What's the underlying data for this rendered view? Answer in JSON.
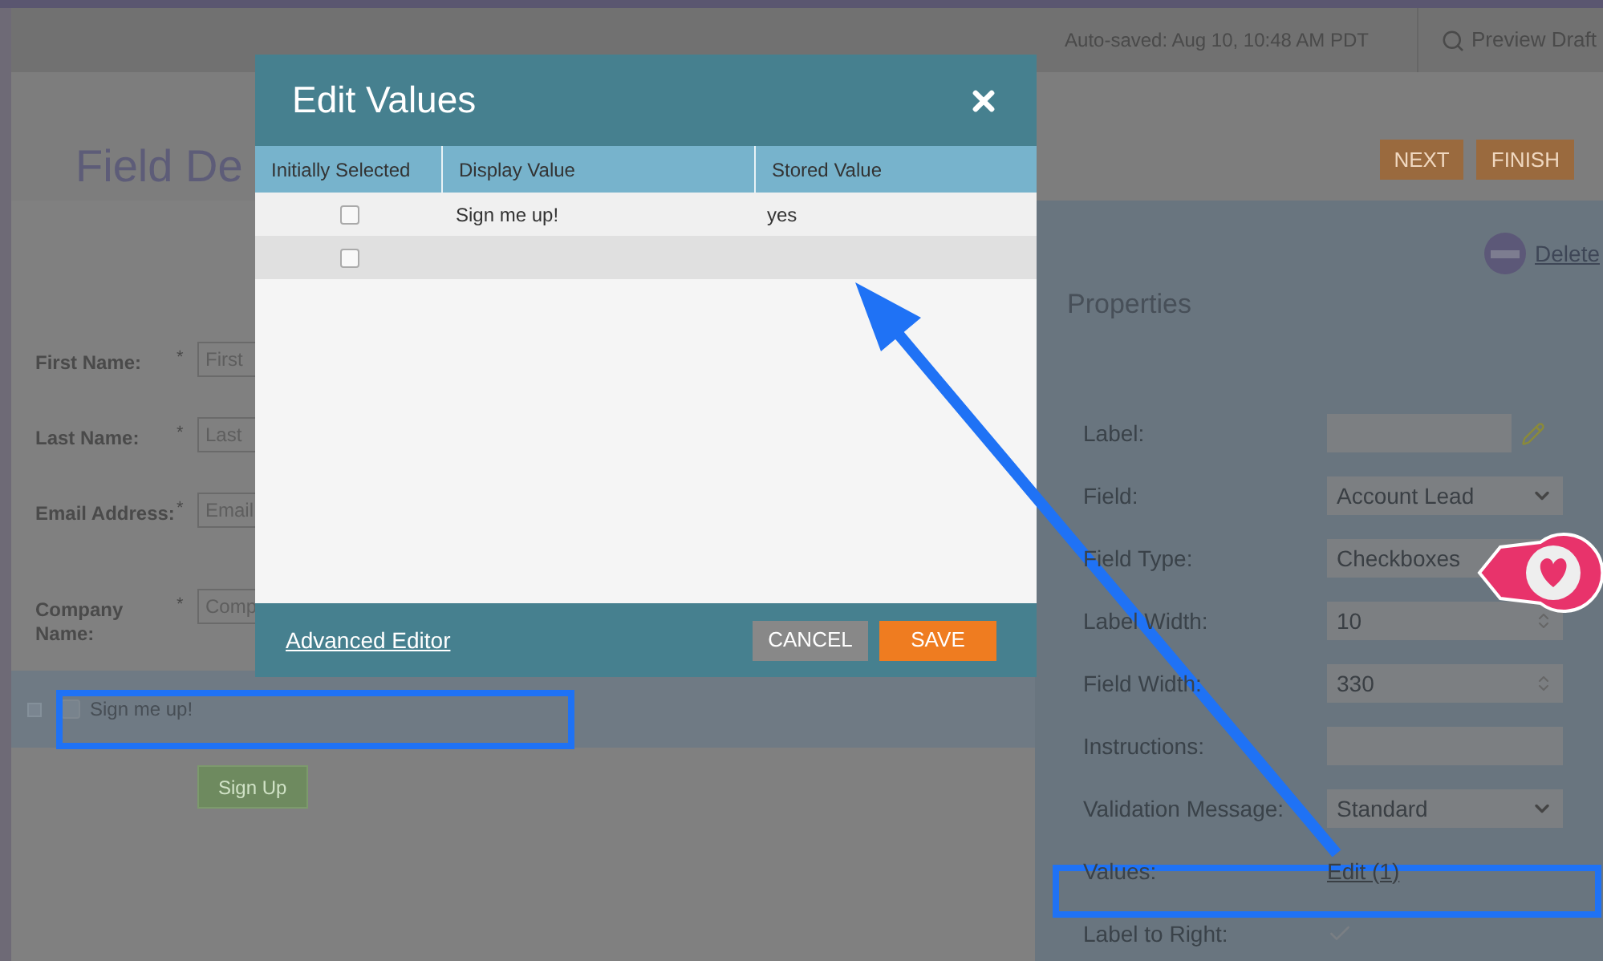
{
  "top_bar": {
    "autosave": "Auto-saved: Aug 10, 10:48 AM PDT",
    "preview": "Preview Draft"
  },
  "header": {
    "title": "Field De",
    "buttons": [
      "NEXT",
      "FINISH"
    ]
  },
  "form": {
    "fields": [
      {
        "label": "First Name:",
        "marker": "*",
        "placeholder": "First"
      },
      {
        "label": "Last Name:",
        "marker": "*",
        "placeholder": "Last"
      },
      {
        "label": "Email Address:",
        "marker": "*",
        "placeholder": "Email"
      },
      {
        "label": "Company Name:",
        "marker": "*",
        "placeholder": "Comp"
      }
    ],
    "checkbox": {
      "label": "Sign me up!",
      "checked": false
    },
    "submit": "Sign Up"
  },
  "properties": {
    "delete": "Delete",
    "title": "Properties",
    "rows": [
      {
        "label": "Label:",
        "kind": "editable"
      },
      {
        "label": "Field:",
        "kind": "select",
        "value": "Account Lead",
        "arrow": true
      },
      {
        "label": "Field Type:",
        "kind": "select",
        "value": "Checkboxes"
      },
      {
        "label": "Label Width:",
        "kind": "number",
        "value": "10"
      },
      {
        "label": "Field Width:",
        "kind": "number",
        "value": "330"
      },
      {
        "label": "Instructions:",
        "kind": "text"
      },
      {
        "label": "Validation Message:",
        "kind": "select",
        "value": "Standard",
        "arrow": true
      },
      {
        "label": "Values:",
        "kind": "link",
        "value": "Edit (1)"
      },
      {
        "label": "Label to Right:",
        "kind": "check",
        "checked": true
      }
    ]
  },
  "modal": {
    "title": "Edit Values",
    "columns": [
      "Initially Selected",
      "Display Value",
      "Stored Value"
    ],
    "rows": [
      {
        "checked": false,
        "display": "Sign me up!",
        "stored": "yes"
      },
      {
        "checked": false
      }
    ],
    "advanced": "Advanced Editor",
    "buttons": [
      "CANCEL",
      "SAVE"
    ]
  }
}
